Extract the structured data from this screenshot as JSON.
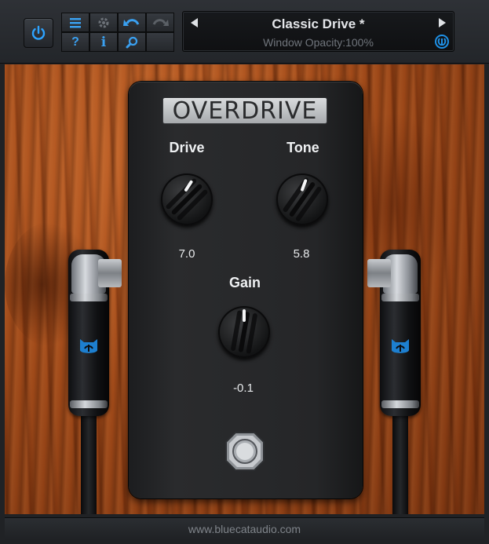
{
  "toolbar": {
    "buttons": [
      "menu",
      "settings",
      "undo",
      "redo",
      "help",
      "info",
      "search",
      ""
    ],
    "power_state": "on",
    "accent": "#1e90e6"
  },
  "preset": {
    "name": "Classic Drive *",
    "status": "Window Opacity:100%"
  },
  "pedal": {
    "title": "OVERDRIVE",
    "knobs": [
      {
        "label": "Drive",
        "value": "7.0"
      },
      {
        "label": "Tone",
        "value": "5.8"
      },
      {
        "label": "Gain",
        "value": "-0.1"
      }
    ]
  },
  "footer": {
    "url": "www.bluecataudio.com"
  }
}
